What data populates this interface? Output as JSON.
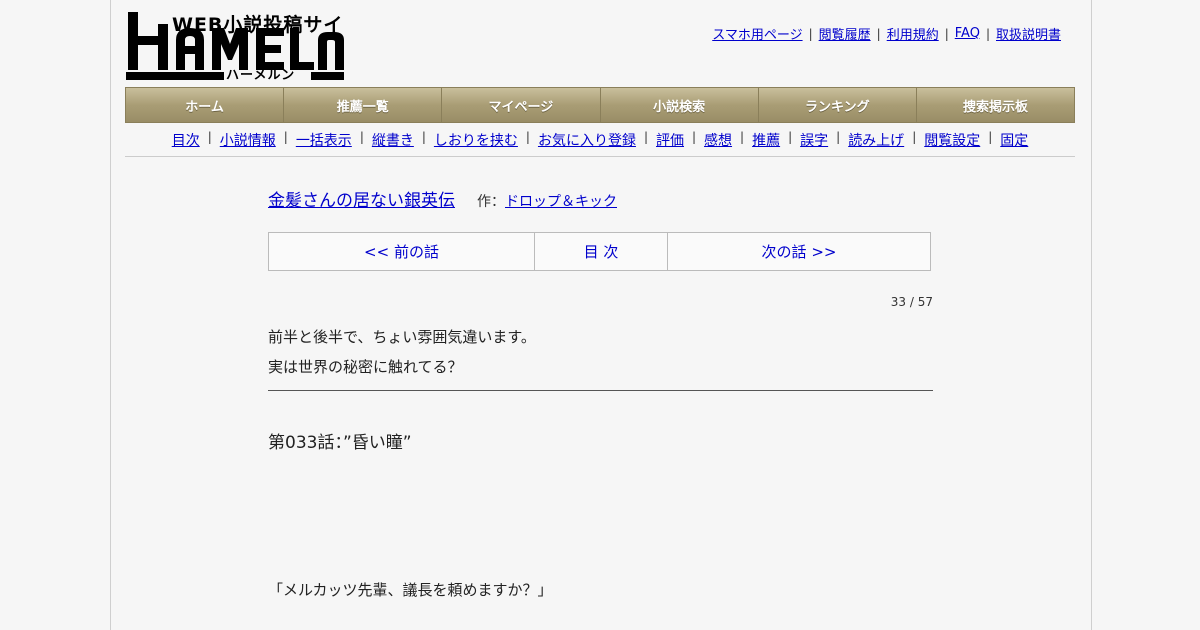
{
  "logo": {
    "tagline": "WEB小説投稿サイト",
    "name": "HAMELN",
    "kana": "ハーメルン"
  },
  "top_links": [
    "スマホ用ページ",
    "閲覧履歴",
    "利用規約",
    "FAQ",
    "取扱説明書"
  ],
  "global_nav": [
    "ホーム",
    "推薦一覧",
    "マイページ",
    "小説検索",
    "ランキング",
    "捜索掲示板"
  ],
  "sub_nav": [
    "目次",
    "小説情報",
    "一括表示",
    "縦書き",
    "しおりを挟む",
    "お気に入り登録",
    "評価",
    "感想",
    "推薦",
    "誤字",
    "読み上げ",
    "閲覧設定",
    "固定"
  ],
  "novel": {
    "title": "金髪さんの居ない銀英伝",
    "author_prefix": "作：",
    "author": "ドロップ＆キック"
  },
  "chapter_nav": {
    "prev": "<< 前の話",
    "toc": "目 次",
    "next": "次の話 >>"
  },
  "progress": "33 / 57",
  "preface": [
    "前半と後半で、ちょい雰囲気違います。",
    "実は世界の秘密に触れてる？"
  ],
  "chapter_title": "第033話：”昏い瞳”",
  "body_first_line": "「メルカッツ先輩、議長を頼めますか？」",
  "colors": {
    "link": "#0000cc",
    "nav_bg": "#a99d75",
    "background": "#f6f6f6"
  }
}
